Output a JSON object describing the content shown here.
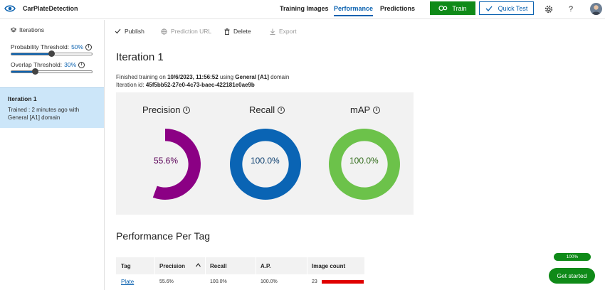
{
  "header": {
    "app_title": "CarPlateDetection",
    "nav": [
      "Training Images",
      "Performance",
      "Predictions"
    ],
    "active_nav": "Performance",
    "train_label": "Train",
    "quick_test_label": "Quick Test",
    "help_label": "?"
  },
  "sidebar": {
    "heading": "Iterations",
    "prob_label": "Probability Threshold:",
    "prob_value": "50%",
    "prob_level": 0.5,
    "overlap_label": "Overlap Threshold:",
    "overlap_value": "30%",
    "overlap_level": 0.3,
    "iteration": {
      "title": "Iteration 1",
      "desc": "Trained : 2 minutes ago with General [A1] domain"
    }
  },
  "toolbar": {
    "publish": "Publish",
    "prediction_url": "Prediction URL",
    "delete": "Delete",
    "export": "Export"
  },
  "main": {
    "title": "Iteration 1",
    "finished_prefix": "Finished training on",
    "finished_date": "10/6/2023, 11:56:52",
    "finished_mid": "using",
    "finished_domain": "General [A1]",
    "finished_suffix": "domain",
    "iter_id_label": "Iteration id:",
    "iter_id": "45f5bb52-27e0-4c73-baec-422181e0ae9b"
  },
  "metrics": [
    {
      "name": "Precision",
      "label": "55.6%",
      "value": 55.6,
      "color": "#8b0084",
      "text_color": "#5a0057"
    },
    {
      "name": "Recall",
      "label": "100.0%",
      "value": 100.0,
      "color": "#0a64b4",
      "text_color": "#0a3d6e"
    },
    {
      "name": "mAP",
      "label": "100.0%",
      "value": 100.0,
      "color": "#6cc24a",
      "text_color": "#2e6a17"
    }
  ],
  "per_tag": {
    "title": "Performance Per Tag",
    "columns": [
      "Tag",
      "Precision",
      "Recall",
      "A.P.",
      "Image count"
    ],
    "rows": [
      {
        "tag": "Plate",
        "precision": "55.6%",
        "recall": "100.0%",
        "ap": "100.0%",
        "image_count": "23"
      }
    ]
  },
  "footer": {
    "progress_label": "100%",
    "progress_value": 1.0,
    "get_started": "Get started"
  }
}
